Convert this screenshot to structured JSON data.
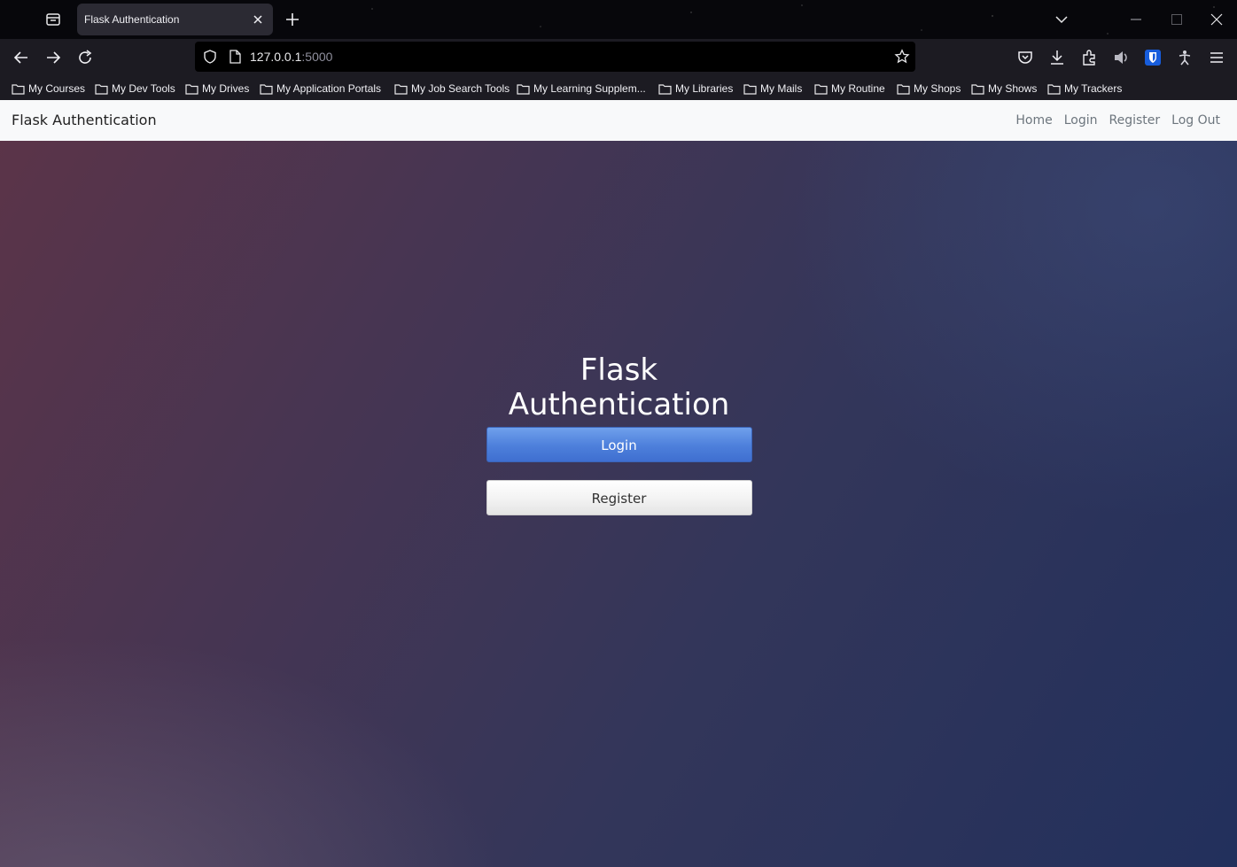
{
  "browser": {
    "tab_title": "Flask Authentication",
    "url_host": "127.0.0.1",
    "url_port": ":5000",
    "bookmarks": [
      "My Courses",
      "My Dev Tools",
      "My Drives",
      "My Application Portals",
      "My Job Search Tools",
      "My Learning Supplem...",
      "My Libraries",
      "My Mails",
      "My Routine",
      "My Shops",
      "My Shows",
      "My Trackers"
    ]
  },
  "site": {
    "brand": "Flask Authentication",
    "nav": [
      "Home",
      "Login",
      "Register",
      "Log Out"
    ],
    "hero_title": "Flask Authentication",
    "login_label": "Login",
    "register_label": "Register"
  },
  "colors": {
    "login_button": "#4d7fdb",
    "navbar_bg": "#f8f9fa"
  }
}
